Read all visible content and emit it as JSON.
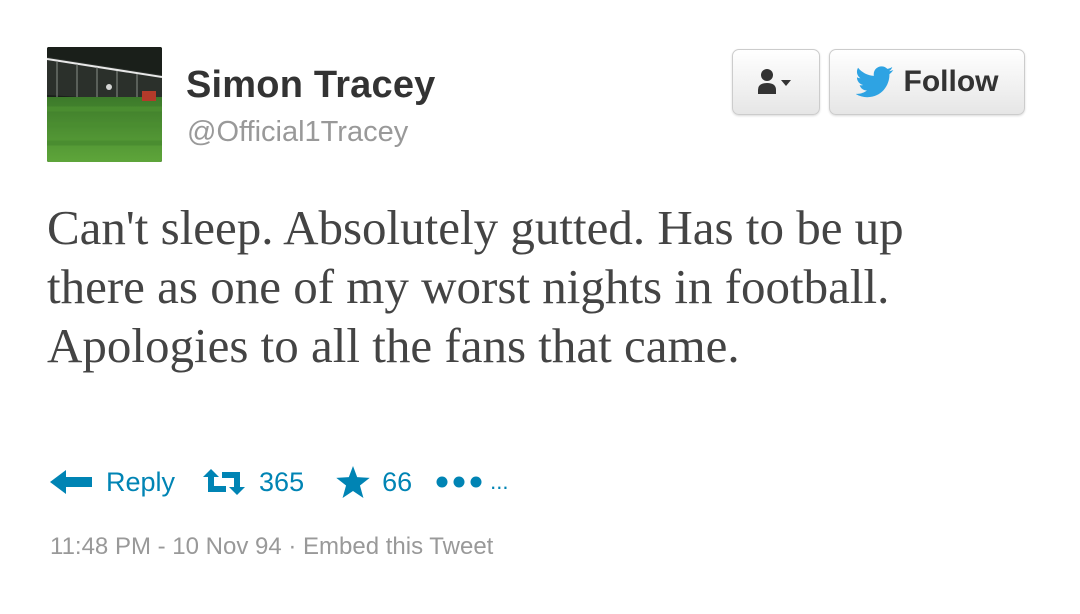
{
  "author": {
    "display_name": "Simon Tracey",
    "handle": "@Official1Tracey",
    "avatar_icon": "stadium-pitch-photo"
  },
  "buttons": {
    "user_menu_icon": "person-dropdown-icon",
    "follow_label": "Follow",
    "follow_icon": "twitter-bird-icon"
  },
  "tweet": {
    "text": "Can't sleep. Absolutely gutted. Has to be up there as one of my worst nights in football. Apologies to all the fans that came."
  },
  "actions": {
    "reply_label": "Reply",
    "retweet_count": "365",
    "favorite_count": "66",
    "more_label": "..."
  },
  "meta": {
    "timestamp": "11:48 PM - 10 Nov 94",
    "separator": " · ",
    "embed_label": "Embed this Tweet"
  },
  "colors": {
    "link_blue": "#0084b4",
    "twitter_blue": "#2ea3e3",
    "muted_gray": "#999999"
  }
}
